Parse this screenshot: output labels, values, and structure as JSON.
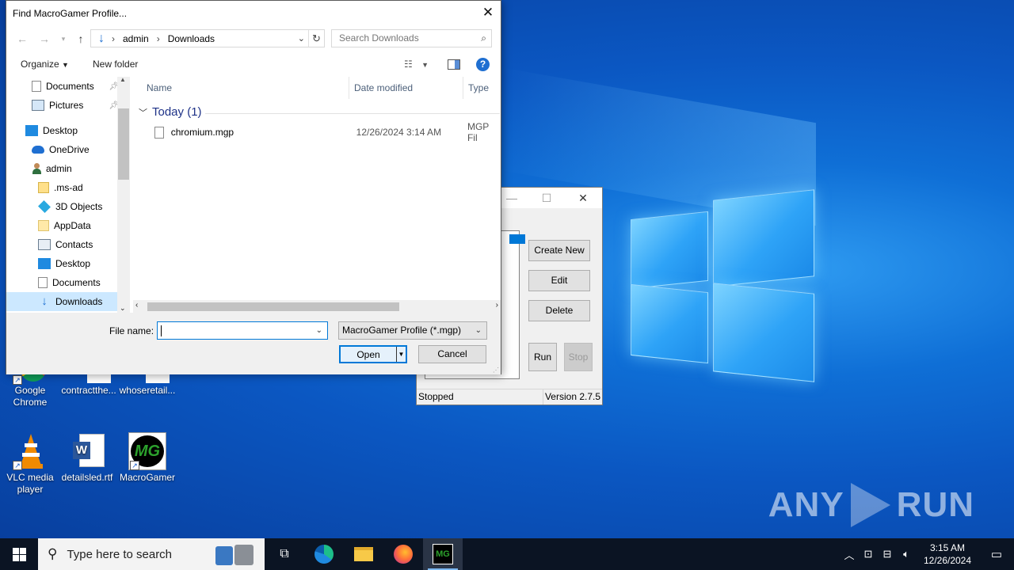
{
  "desktop": {
    "icons": [
      {
        "label": "Google Chrome"
      },
      {
        "label": "contractthe..."
      },
      {
        "label": "whoseretail..."
      },
      {
        "label": "VLC media player"
      },
      {
        "label": "detailsled.rtf"
      },
      {
        "label": "MacroGamer"
      }
    ],
    "watermark": {
      "left": "ANY",
      "right": "RUN"
    }
  },
  "macrogamer": {
    "buttons": {
      "create_new": "Create New",
      "edit": "Edit",
      "delete": "Delete",
      "run": "Run",
      "stop": "Stop"
    },
    "status": "Stopped",
    "version": "Version 2.7.5"
  },
  "dialog": {
    "title": "Find MacroGamer Profile...",
    "breadcrumb": [
      "admin",
      "Downloads"
    ],
    "search_placeholder": "Search Downloads",
    "toolbar": {
      "organize": "Organize",
      "new_folder": "New folder"
    },
    "tree": [
      {
        "label": "Documents",
        "pinned": true,
        "selected": false
      },
      {
        "label": "Pictures",
        "pinned": true,
        "selected": false
      },
      {
        "label": "Desktop",
        "pinned": false,
        "selected": false
      },
      {
        "label": "OneDrive",
        "pinned": false,
        "selected": false
      },
      {
        "label": "admin",
        "pinned": false,
        "selected": false
      },
      {
        "label": ".ms-ad",
        "pinned": false,
        "selected": false
      },
      {
        "label": "3D Objects",
        "pinned": false,
        "selected": false
      },
      {
        "label": "AppData",
        "pinned": false,
        "selected": false
      },
      {
        "label": "Contacts",
        "pinned": false,
        "selected": false
      },
      {
        "label": "Desktop",
        "pinned": false,
        "selected": false
      },
      {
        "label": "Documents",
        "pinned": false,
        "selected": false
      },
      {
        "label": "Downloads",
        "pinned": false,
        "selected": true
      }
    ],
    "columns": {
      "name": "Name",
      "date_modified": "Date modified",
      "type": "Type"
    },
    "group_label": "Today (1)",
    "files": [
      {
        "name": "chromium.mgp",
        "date": "12/26/2024 3:14 AM",
        "type": "MGP Fil"
      }
    ],
    "file_name_label": "File name:",
    "file_name_value": "",
    "filter": "MacroGamer Profile (*.mgp)",
    "open_label": "Open",
    "cancel_label": "Cancel"
  },
  "taskbar": {
    "search_placeholder": "Type here to search",
    "time": "3:15 AM",
    "date": "12/26/2024"
  }
}
